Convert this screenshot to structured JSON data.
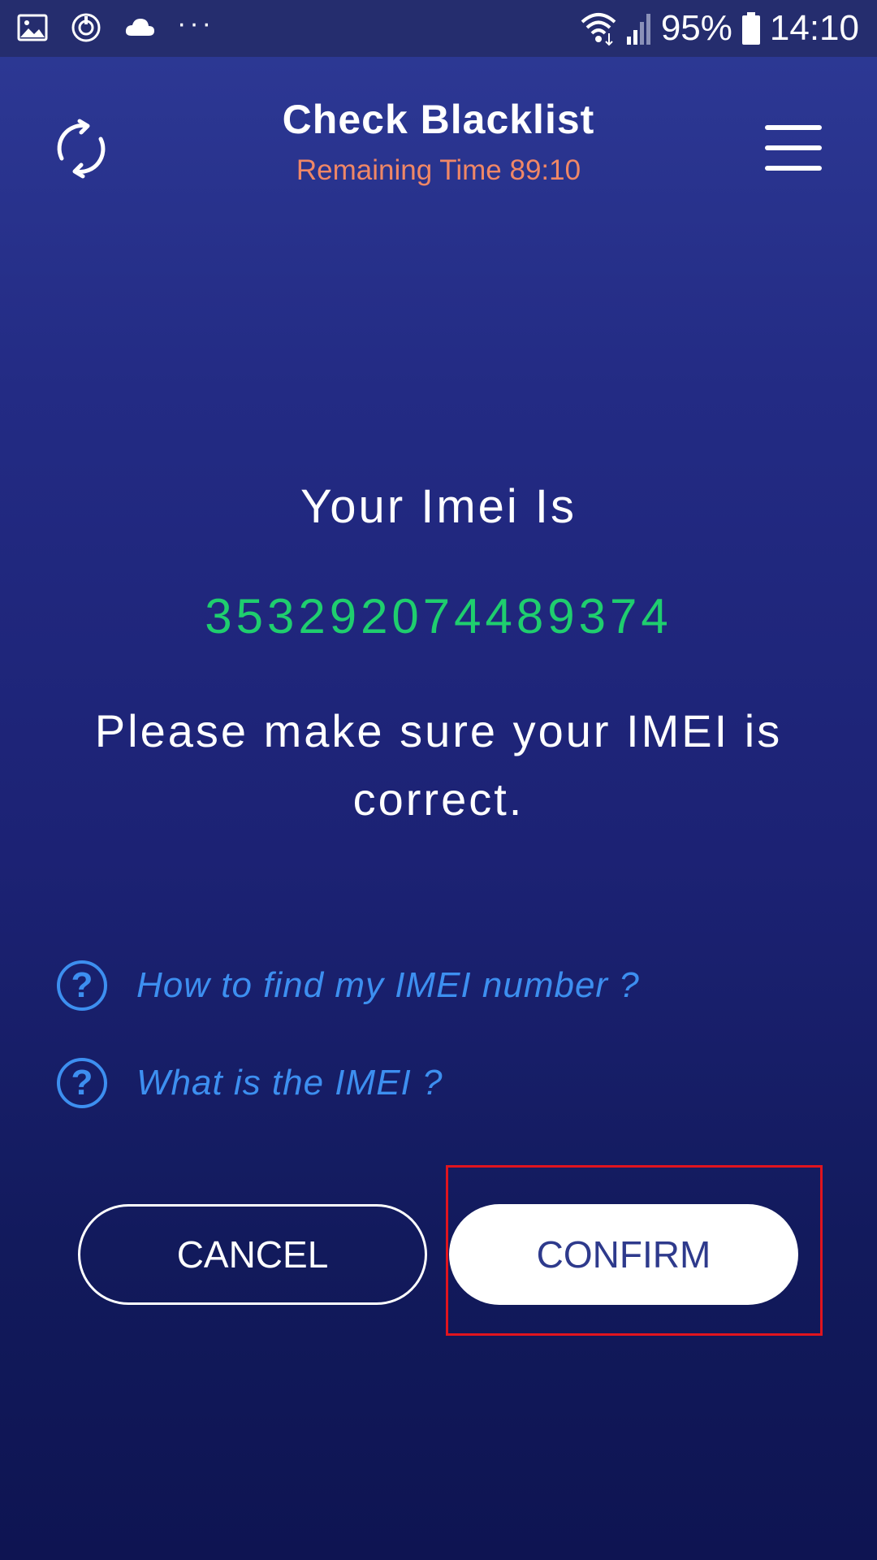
{
  "status_bar": {
    "left_icons": [
      "gallery-icon",
      "sync-icon",
      "cloud-icon"
    ],
    "more_indicator": "···",
    "battery_percent": "95%",
    "time": "14:10"
  },
  "app_bar": {
    "title": "Check Blacklist",
    "subtitle": "Remaining Time 89:10"
  },
  "main": {
    "heading": "Your Imei Is",
    "imei": "353292074489374",
    "note": "Please make sure your IMEI is correct."
  },
  "help_links": [
    {
      "label": "How to find my IMEI number ?"
    },
    {
      "label": "What is the IMEI ?"
    }
  ],
  "buttons": {
    "cancel_label": "CANCEL",
    "confirm_label": "CONFIRM"
  },
  "colors": {
    "background_top": "#2e3a96",
    "background_bottom": "#0e1452",
    "subtitle": "#f08766",
    "imei_value": "#1fce6e",
    "help_link": "#3d8ff0",
    "confirm_text": "#2e3a8c",
    "highlight": "#e0141e"
  }
}
